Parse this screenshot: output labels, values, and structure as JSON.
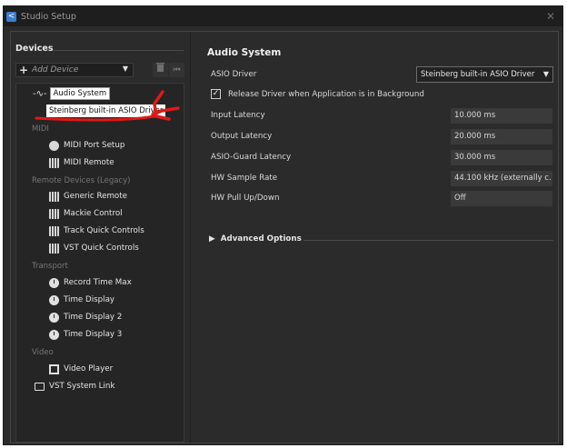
{
  "window": {
    "title": "Studio Setup"
  },
  "devices": {
    "title": "Devices",
    "add_device": "Add Device",
    "tree": {
      "audio_system": "Audio System",
      "asio_driver": "Steinberg built-in ASIO Driver",
      "cat_midi": "MIDI",
      "midi_port_setup": "MIDI Port Setup",
      "midi_remote": "MIDI Remote",
      "cat_remote": "Remote Devices (Legacy)",
      "generic_remote": "Generic Remote",
      "mackie_control": "Mackie Control",
      "track_quick_controls": "Track Quick Controls",
      "vst_quick_controls": "VST Quick Controls",
      "cat_transport": "Transport",
      "record_time_max": "Record Time Max",
      "time_display": "Time Display",
      "time_display_2": "Time Display 2",
      "time_display_3": "Time Display 3",
      "cat_video": "Video",
      "video_player": "Video Player",
      "vst_system_link": "VST System Link"
    }
  },
  "audio_system": {
    "title": "Audio System",
    "asio_driver_label": "ASIO Driver",
    "asio_driver_value": "Steinberg built-in ASIO Driver",
    "release_driver_label": "Release Driver when Application is in Background",
    "release_driver_checked": true,
    "input_latency_label": "Input Latency",
    "input_latency_value": "10.000 ms",
    "output_latency_label": "Output Latency",
    "output_latency_value": "20.000 ms",
    "asio_guard_label": "ASIO-Guard Latency",
    "asio_guard_value": "30.000 ms",
    "sample_rate_label": "HW Sample Rate",
    "sample_rate_value": "44.100 kHz (externally c.",
    "pull_label": "HW Pull Up/Down",
    "pull_value": "Off",
    "advanced_options": "Advanced Options"
  },
  "colors": {
    "background": "#2b2b2b",
    "titlebar": "#1e1e1e",
    "annotation_red": "#e01818",
    "app_icon": "#3a7fd4"
  },
  "icons": [
    "app-icon",
    "close-icon",
    "plus-icon",
    "chevron-down-icon",
    "trash-icon",
    "rewind-icon",
    "waveform-icon",
    "midi-port-icon",
    "keyboard-icon",
    "clock-icon",
    "video-icon",
    "monitor-icon",
    "checkbox-icon",
    "triangle-right-icon"
  ]
}
